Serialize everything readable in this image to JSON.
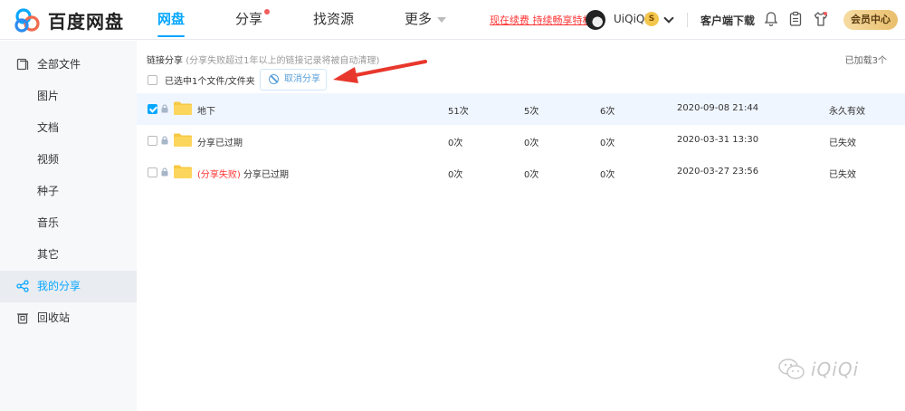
{
  "header": {
    "logo_text": "百度网盘",
    "nav": [
      {
        "label": "网盘",
        "active": true
      },
      {
        "label": "分享",
        "dot": true
      },
      {
        "label": "找资源"
      },
      {
        "label": "更多",
        "caret": true
      }
    ],
    "renew_text": "现在续费 持续畅享特权",
    "username": "UiQiQi",
    "vip_badge": "S",
    "client_download": "客户端下载",
    "vip_center": "会员中心"
  },
  "sidebar": {
    "items": [
      {
        "label": "全部文件",
        "icon": "all-files-icon"
      },
      {
        "label": "图片"
      },
      {
        "label": "文档"
      },
      {
        "label": "视频"
      },
      {
        "label": "种子"
      },
      {
        "label": "音乐"
      },
      {
        "label": "其它"
      },
      {
        "label": "我的分享",
        "icon": "share-icon",
        "active": true
      },
      {
        "label": "回收站",
        "icon": "trash-icon"
      }
    ]
  },
  "main": {
    "title": "链接分享",
    "title_note": "(分享失败超过1年以上的链接记录将被自动清理)",
    "loaded_text": "已加载3个",
    "selected_text": "已选中1个文件/文件夹",
    "cancel_share_label": "取消分享",
    "rows": [
      {
        "name": "地下",
        "fail_prefix": "",
        "views": "51次",
        "saves": "5次",
        "downloads": "6次",
        "time": "2020-09-08 21:44",
        "status": "永久有效",
        "checked": true
      },
      {
        "name": "分享已过期",
        "fail_prefix": "",
        "views": "0次",
        "saves": "0次",
        "downloads": "0次",
        "time": "2020-03-31 13:30",
        "status": "已失效",
        "checked": false
      },
      {
        "name": "分享已过期",
        "fail_prefix": "(分享失败)",
        "views": "0次",
        "saves": "0次",
        "downloads": "0次",
        "time": "2020-03-27 23:56",
        "status": "已失效",
        "checked": false
      }
    ]
  },
  "watermark": "iQiQi",
  "colors": {
    "accent": "#06a7ff",
    "danger": "#f33",
    "arrow": "#e8372c",
    "folder": "#f7c843"
  }
}
